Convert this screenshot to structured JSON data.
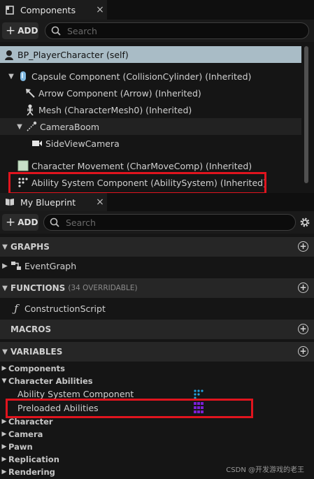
{
  "components_panel": {
    "tab_label": "Components",
    "close_glyph": "×",
    "add_label": "ADD",
    "search_placeholder": "Search",
    "self_item": "BP_PlayerCharacter (self)",
    "tree": [
      {
        "label": "Capsule Component (CollisionCylinder) (Inherited)",
        "icon": "capsule-icon"
      },
      {
        "label": "Arrow Component (Arrow) (Inherited)",
        "icon": "arrow-component-icon"
      },
      {
        "label": "Mesh (CharacterMesh0) (Inherited)",
        "icon": "skeleton-mesh-icon"
      },
      {
        "label": "CameraBoom",
        "icon": "spring-arm-icon"
      },
      {
        "label": "SideViewCamera",
        "icon": "camera-icon"
      },
      {
        "label": "Character Movement (CharMoveComp) (Inherited)",
        "icon": "movement-icon"
      },
      {
        "label": "Ability System Component (AbilitySystem) (Inherited)",
        "icon": "ability-system-icon"
      }
    ]
  },
  "blueprint_panel": {
    "tab_label": "My Blueprint",
    "close_glyph": "×",
    "add_label": "ADD",
    "search_placeholder": "Search",
    "graphs": {
      "title": "GRAPHS",
      "items": [
        "EventGraph"
      ]
    },
    "functions": {
      "title": "FUNCTIONS",
      "count_label": "(34 OVERRIDABLE)",
      "items": [
        "ConstructionScript"
      ]
    },
    "macros": {
      "title": "MACROS"
    },
    "variables": {
      "title": "VARIABLES",
      "categories": [
        "Components",
        "Character Abilities",
        "Character",
        "Camera",
        "Pawn",
        "Replication",
        "Rendering"
      ],
      "character_abilities_items": [
        "Ability System Component",
        "Preloaded Abilities"
      ]
    }
  },
  "colors": {
    "highlight_red": "#e0141e",
    "selected_row": "#a9bcc6",
    "variable_blue": "#1fa3e0",
    "variable_purple": "#7a1fd4"
  },
  "watermark": "CSDN @开发游戏的老王"
}
